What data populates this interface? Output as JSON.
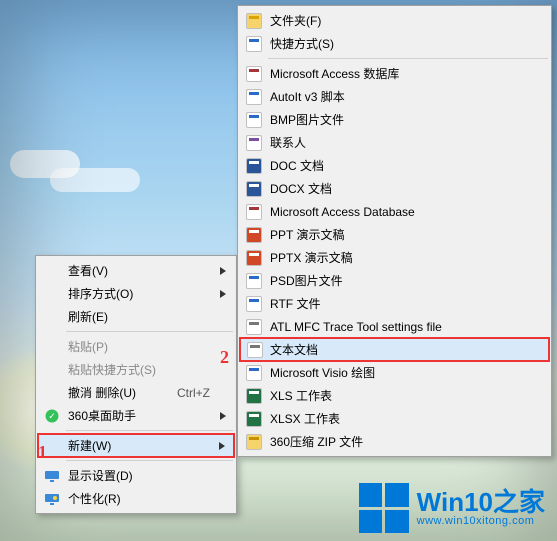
{
  "annotations": {
    "num1": "1",
    "num2": "2"
  },
  "primary_menu": {
    "view": "查看(V)",
    "sort": "排序方式(O)",
    "refresh": "刷新(E)",
    "paste": "粘贴(P)",
    "paste_shortcut": "粘贴快捷方式(S)",
    "undo_delete": "撤消 删除(U)",
    "undo_delete_key": "Ctrl+Z",
    "desk_helper": "360桌面助手",
    "new": "新建(W)",
    "display_settings": "显示设置(D)",
    "personalize": "个性化(R)"
  },
  "secondary_menu": {
    "items": [
      {
        "label": "文件夹(F)",
        "icon": "folder-icon",
        "icon_bg": "#f6d36b",
        "icon_fg": "#d9a400",
        "hi": false
      },
      {
        "label": "快捷方式(S)",
        "icon": "shortcut-icon",
        "icon_bg": "#ffffff",
        "icon_fg": "#2a6bc6",
        "hi": false
      },
      {
        "label": "Microsoft Access 数据库",
        "icon": "access-icon",
        "icon_bg": "#ffffff",
        "icon_fg": "#a4373a",
        "hi": false
      },
      {
        "label": "AutoIt v3 脚本",
        "icon": "autoit-icon",
        "icon_bg": "#ffffff",
        "icon_fg": "#2a6bc6",
        "hi": false
      },
      {
        "label": "BMP图片文件",
        "icon": "bmp-icon",
        "icon_bg": "#ffffff",
        "icon_fg": "#2a6bc6",
        "hi": false
      },
      {
        "label": "联系人",
        "icon": "contact-icon",
        "icon_bg": "#ffffff",
        "icon_fg": "#7a4fa0",
        "hi": false
      },
      {
        "label": "DOC 文档",
        "icon": "doc-icon",
        "icon_bg": "#2a5699",
        "icon_fg": "#ffffff",
        "hi": false
      },
      {
        "label": "DOCX 文档",
        "icon": "docx-icon",
        "icon_bg": "#2a5699",
        "icon_fg": "#ffffff",
        "hi": false
      },
      {
        "label": "Microsoft Access Database",
        "icon": "access-db-icon",
        "icon_bg": "#ffffff",
        "icon_fg": "#a4373a",
        "hi": false
      },
      {
        "label": "PPT 演示文稿",
        "icon": "ppt-icon",
        "icon_bg": "#d24726",
        "icon_fg": "#ffffff",
        "hi": false
      },
      {
        "label": "PPTX 演示文稿",
        "icon": "pptx-icon",
        "icon_bg": "#d24726",
        "icon_fg": "#ffffff",
        "hi": false
      },
      {
        "label": "PSD图片文件",
        "icon": "psd-icon",
        "icon_bg": "#ffffff",
        "icon_fg": "#2a6bc6",
        "hi": false
      },
      {
        "label": "RTF 文件",
        "icon": "rtf-icon",
        "icon_bg": "#ffffff",
        "icon_fg": "#2a6bc6",
        "hi": false
      },
      {
        "label": "ATL MFC Trace Tool settings file",
        "icon": "trace-icon",
        "icon_bg": "#ffffff",
        "icon_fg": "#777777",
        "hi": false
      },
      {
        "label": "文本文档",
        "icon": "text-icon",
        "icon_bg": "#ffffff",
        "icon_fg": "#777777",
        "hi": true
      },
      {
        "label": "Microsoft Visio 绘图",
        "icon": "visio-icon",
        "icon_bg": "#ffffff",
        "icon_fg": "#2a6bc6",
        "hi": false
      },
      {
        "label": "XLS 工作表",
        "icon": "xls-icon",
        "icon_bg": "#217346",
        "icon_fg": "#ffffff",
        "hi": false
      },
      {
        "label": "XLSX 工作表",
        "icon": "xlsx-icon",
        "icon_bg": "#217346",
        "icon_fg": "#ffffff",
        "hi": false
      },
      {
        "label": "360压缩 ZIP 文件",
        "icon": "zip-icon",
        "icon_bg": "#f6d36b",
        "icon_fg": "#c79200",
        "hi": false
      }
    ]
  },
  "logo": {
    "brand": "Win10之家",
    "url": "www.win10xitong.com"
  }
}
